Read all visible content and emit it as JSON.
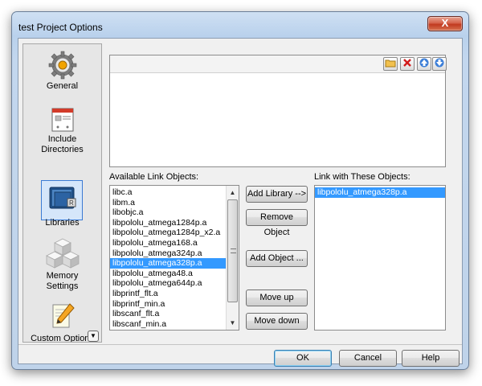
{
  "window": {
    "title": "test Project Options",
    "close_label": "X"
  },
  "categories": [
    {
      "label": "General",
      "icon": "gear-icon"
    },
    {
      "label": "Include\nDirectories",
      "icon": "folder-list-icon"
    },
    {
      "label": "Libraries",
      "icon": "books-icon",
      "selected": true
    },
    {
      "label": "Memory\nSettings",
      "icon": "cubes-icon"
    },
    {
      "label": "Custom Options",
      "icon": "pencil-note-icon"
    }
  ],
  "toolbar": {
    "new_folder_icon": "folder-icon",
    "delete_icon": "delete-icon",
    "move_up_icon": "arrow-up-icon",
    "move_down_icon": "arrow-down-icon"
  },
  "available": {
    "label": "Available Link Objects:",
    "items": [
      "libc.a",
      "libm.a",
      "libobjc.a",
      "libpololu_atmega1284p.a",
      "libpololu_atmega1284p_x2.a",
      "libpololu_atmega168.a",
      "libpololu_atmega324p.a",
      "libpololu_atmega328p.a",
      "libpololu_atmega48.a",
      "libpololu_atmega644p.a",
      "libprintf_flt.a",
      "libprintf_min.a",
      "libscanf_flt.a",
      "libscanf_min.a"
    ],
    "selected_index": 7
  },
  "linked": {
    "label": "Link with These Objects:",
    "items": [
      "libpololu_atmega328p.a"
    ],
    "selected_index": 0
  },
  "buttons": {
    "add_library": "Add Library -->",
    "remove_object": "Remove Object",
    "add_object": "Add Object ...",
    "move_up": "Move up",
    "move_down": "Move down",
    "ok": "OK",
    "cancel": "Cancel",
    "help": "Help"
  }
}
